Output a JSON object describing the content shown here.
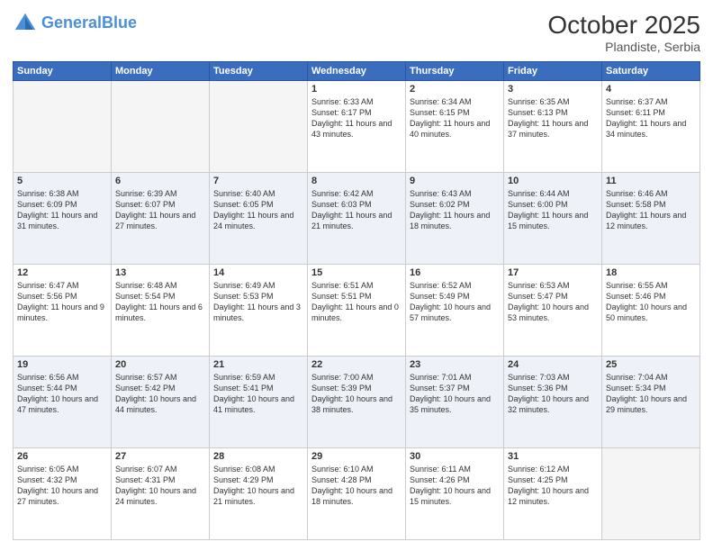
{
  "header": {
    "logo_general": "General",
    "logo_blue": "Blue",
    "month_title": "October 2025",
    "location": "Plandiste, Serbia"
  },
  "weekdays": [
    "Sunday",
    "Monday",
    "Tuesday",
    "Wednesday",
    "Thursday",
    "Friday",
    "Saturday"
  ],
  "weeks": [
    {
      "days": [
        {
          "num": "",
          "info": ""
        },
        {
          "num": "",
          "info": ""
        },
        {
          "num": "",
          "info": ""
        },
        {
          "num": "1",
          "info": "Sunrise: 6:33 AM\nSunset: 6:17 PM\nDaylight: 11 hours\nand 43 minutes."
        },
        {
          "num": "2",
          "info": "Sunrise: 6:34 AM\nSunset: 6:15 PM\nDaylight: 11 hours\nand 40 minutes."
        },
        {
          "num": "3",
          "info": "Sunrise: 6:35 AM\nSunset: 6:13 PM\nDaylight: 11 hours\nand 37 minutes."
        },
        {
          "num": "4",
          "info": "Sunrise: 6:37 AM\nSunset: 6:11 PM\nDaylight: 11 hours\nand 34 minutes."
        }
      ]
    },
    {
      "days": [
        {
          "num": "5",
          "info": "Sunrise: 6:38 AM\nSunset: 6:09 PM\nDaylight: 11 hours\nand 31 minutes."
        },
        {
          "num": "6",
          "info": "Sunrise: 6:39 AM\nSunset: 6:07 PM\nDaylight: 11 hours\nand 27 minutes."
        },
        {
          "num": "7",
          "info": "Sunrise: 6:40 AM\nSunset: 6:05 PM\nDaylight: 11 hours\nand 24 minutes."
        },
        {
          "num": "8",
          "info": "Sunrise: 6:42 AM\nSunset: 6:03 PM\nDaylight: 11 hours\nand 21 minutes."
        },
        {
          "num": "9",
          "info": "Sunrise: 6:43 AM\nSunset: 6:02 PM\nDaylight: 11 hours\nand 18 minutes."
        },
        {
          "num": "10",
          "info": "Sunrise: 6:44 AM\nSunset: 6:00 PM\nDaylight: 11 hours\nand 15 minutes."
        },
        {
          "num": "11",
          "info": "Sunrise: 6:46 AM\nSunset: 5:58 PM\nDaylight: 11 hours\nand 12 minutes."
        }
      ]
    },
    {
      "days": [
        {
          "num": "12",
          "info": "Sunrise: 6:47 AM\nSunset: 5:56 PM\nDaylight: 11 hours\nand 9 minutes."
        },
        {
          "num": "13",
          "info": "Sunrise: 6:48 AM\nSunset: 5:54 PM\nDaylight: 11 hours\nand 6 minutes."
        },
        {
          "num": "14",
          "info": "Sunrise: 6:49 AM\nSunset: 5:53 PM\nDaylight: 11 hours\nand 3 minutes."
        },
        {
          "num": "15",
          "info": "Sunrise: 6:51 AM\nSunset: 5:51 PM\nDaylight: 11 hours\nand 0 minutes."
        },
        {
          "num": "16",
          "info": "Sunrise: 6:52 AM\nSunset: 5:49 PM\nDaylight: 10 hours\nand 57 minutes."
        },
        {
          "num": "17",
          "info": "Sunrise: 6:53 AM\nSunset: 5:47 PM\nDaylight: 10 hours\nand 53 minutes."
        },
        {
          "num": "18",
          "info": "Sunrise: 6:55 AM\nSunset: 5:46 PM\nDaylight: 10 hours\nand 50 minutes."
        }
      ]
    },
    {
      "days": [
        {
          "num": "19",
          "info": "Sunrise: 6:56 AM\nSunset: 5:44 PM\nDaylight: 10 hours\nand 47 minutes."
        },
        {
          "num": "20",
          "info": "Sunrise: 6:57 AM\nSunset: 5:42 PM\nDaylight: 10 hours\nand 44 minutes."
        },
        {
          "num": "21",
          "info": "Sunrise: 6:59 AM\nSunset: 5:41 PM\nDaylight: 10 hours\nand 41 minutes."
        },
        {
          "num": "22",
          "info": "Sunrise: 7:00 AM\nSunset: 5:39 PM\nDaylight: 10 hours\nand 38 minutes."
        },
        {
          "num": "23",
          "info": "Sunrise: 7:01 AM\nSunset: 5:37 PM\nDaylight: 10 hours\nand 35 minutes."
        },
        {
          "num": "24",
          "info": "Sunrise: 7:03 AM\nSunset: 5:36 PM\nDaylight: 10 hours\nand 32 minutes."
        },
        {
          "num": "25",
          "info": "Sunrise: 7:04 AM\nSunset: 5:34 PM\nDaylight: 10 hours\nand 29 minutes."
        }
      ]
    },
    {
      "days": [
        {
          "num": "26",
          "info": "Sunrise: 6:05 AM\nSunset: 4:32 PM\nDaylight: 10 hours\nand 27 minutes."
        },
        {
          "num": "27",
          "info": "Sunrise: 6:07 AM\nSunset: 4:31 PM\nDaylight: 10 hours\nand 24 minutes."
        },
        {
          "num": "28",
          "info": "Sunrise: 6:08 AM\nSunset: 4:29 PM\nDaylight: 10 hours\nand 21 minutes."
        },
        {
          "num": "29",
          "info": "Sunrise: 6:10 AM\nSunset: 4:28 PM\nDaylight: 10 hours\nand 18 minutes."
        },
        {
          "num": "30",
          "info": "Sunrise: 6:11 AM\nSunset: 4:26 PM\nDaylight: 10 hours\nand 15 minutes."
        },
        {
          "num": "31",
          "info": "Sunrise: 6:12 AM\nSunset: 4:25 PM\nDaylight: 10 hours\nand 12 minutes."
        },
        {
          "num": "",
          "info": ""
        }
      ]
    }
  ]
}
